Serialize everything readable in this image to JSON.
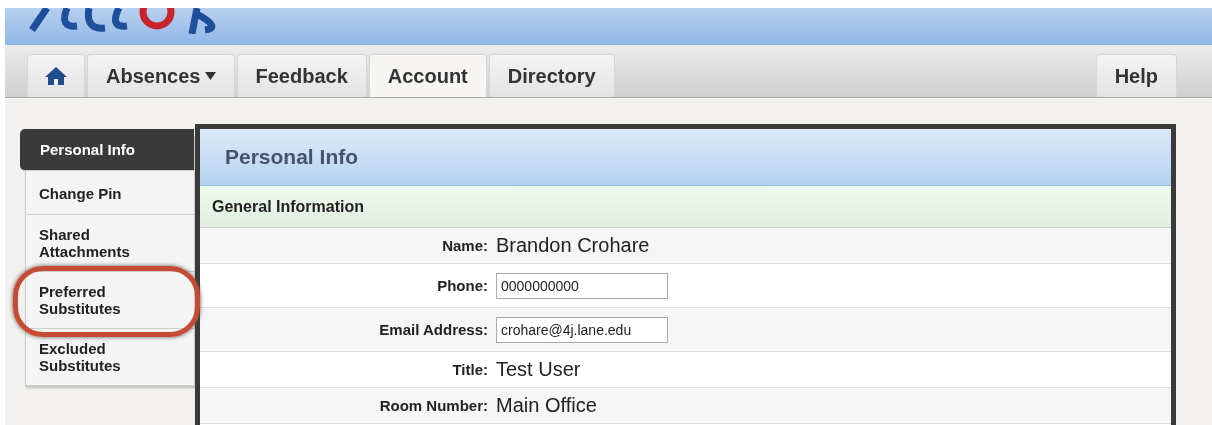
{
  "nav": {
    "tabs": [
      {
        "kind": "home",
        "selected": false
      },
      {
        "kind": "menu",
        "label": "Absences",
        "selected": false
      },
      {
        "kind": "text",
        "label": "Feedback",
        "selected": false
      },
      {
        "kind": "text",
        "label": "Account",
        "selected": true
      },
      {
        "kind": "text",
        "label": "Directory",
        "selected": false
      }
    ],
    "help": "Help"
  },
  "sidebar": {
    "items": [
      {
        "label": "Personal Info",
        "selected": true,
        "circled": false
      },
      {
        "label": "Change Pin",
        "selected": false,
        "circled": false
      },
      {
        "label": "Shared Attachments",
        "selected": false,
        "circled": false
      },
      {
        "label": "Preferred Substitutes",
        "selected": false,
        "circled": true
      },
      {
        "label": "Excluded Substitutes",
        "selected": false,
        "circled": false
      }
    ]
  },
  "panel": {
    "title": "Personal Info",
    "section": "General Information",
    "fields": [
      {
        "kind": "text",
        "label": "Name:",
        "value": "Brandon Crohare"
      },
      {
        "kind": "input",
        "label": "Phone:",
        "value": "0000000000"
      },
      {
        "kind": "input",
        "label": "Email Address:",
        "value": "crohare@4j.lane.edu"
      },
      {
        "kind": "text",
        "label": "Title:",
        "value": "Test User"
      },
      {
        "kind": "text",
        "label": "Room Number:",
        "value": "Main Office"
      }
    ]
  }
}
